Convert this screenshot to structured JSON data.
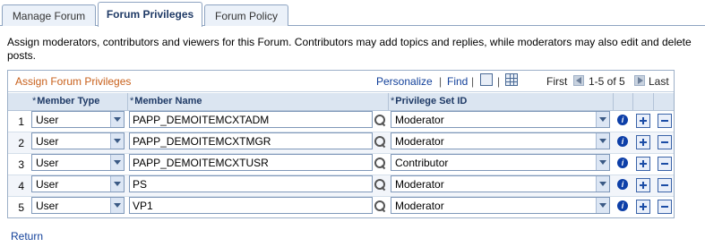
{
  "tabs": [
    {
      "label": "Manage Forum",
      "active": false
    },
    {
      "label": "Forum Privileges",
      "active": true
    },
    {
      "label": "Forum Policy",
      "active": false
    }
  ],
  "description": "Assign moderators, contributors and viewers for this Forum. Contributors may add topics and replies, while moderators may also edit and delete posts.",
  "grid": {
    "title": "Assign Forum Privileges",
    "personalize_label": "Personalize",
    "find_label": "Find",
    "separator": "|",
    "first_label": "First",
    "range_label": "1-5 of 5",
    "last_label": "Last",
    "columns": {
      "member_type": "Member Type",
      "member_name": "Member Name",
      "privilege_set": "Privilege Set ID",
      "required_mark": "*"
    },
    "rows": [
      {
        "num": "1",
        "member_type": "User",
        "member_name": "PAPP_DEMOITEMCXTADM",
        "privilege": "Moderator"
      },
      {
        "num": "2",
        "member_type": "User",
        "member_name": "PAPP_DEMOITEMCXTMGR",
        "privilege": "Moderator"
      },
      {
        "num": "3",
        "member_type": "User",
        "member_name": "PAPP_DEMOITEMCXTUSR",
        "privilege": "Contributor"
      },
      {
        "num": "4",
        "member_type": "User",
        "member_name": "PS",
        "privilege": "Moderator"
      },
      {
        "num": "5",
        "member_type": "User",
        "member_name": "VP1",
        "privilege": "Moderator"
      }
    ]
  },
  "return_label": "Return",
  "colors": {
    "grid_title": "#c8601b",
    "link": "#12409a",
    "header_bg": "#dbe5f1",
    "info_icon": "#0d3fa8"
  }
}
